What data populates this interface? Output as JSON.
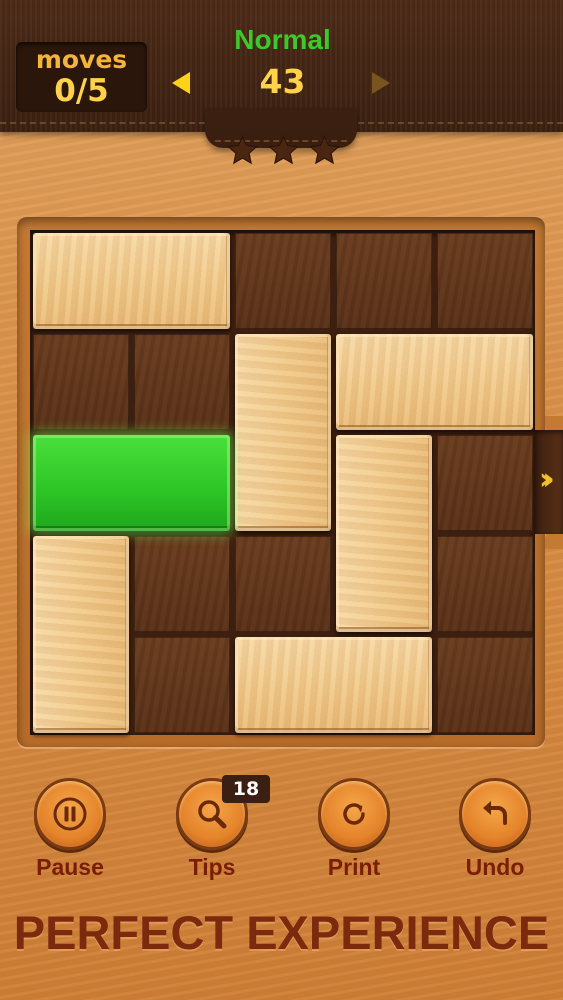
{
  "header": {
    "moves_label": "moves",
    "moves_value": "0/5",
    "difficulty": "Normal",
    "level": "43",
    "prev_level_icon": "arrow-left-icon",
    "next_level_icon": "arrow-right-icon",
    "stars_earned": 3,
    "stars_total": 3
  },
  "board": {
    "rows": 5,
    "cols": 5,
    "blocks": [
      {
        "id": "h-top",
        "type": "wood",
        "orientation": "horizontal",
        "row": 0,
        "col": 0,
        "length": 2
      },
      {
        "id": "v-mid",
        "type": "wood",
        "orientation": "vertical",
        "row": 1,
        "col": 2,
        "length": 2
      },
      {
        "id": "h-right",
        "type": "wood",
        "orientation": "horizontal",
        "row": 1,
        "col": 3,
        "length": 2
      },
      {
        "id": "target",
        "type": "target",
        "orientation": "horizontal",
        "row": 2,
        "col": 0,
        "length": 2
      },
      {
        "id": "v-center",
        "type": "wood",
        "orientation": "vertical",
        "row": 2,
        "col": 3,
        "length": 2
      },
      {
        "id": "v-left",
        "type": "wood",
        "orientation": "vertical",
        "row": 3,
        "col": 0,
        "length": 2
      },
      {
        "id": "h-bottom",
        "type": "wood",
        "orientation": "horizontal",
        "row": 4,
        "col": 2,
        "length": 2
      }
    ],
    "exit_row": 2,
    "exit_icon": "double-chevron-right-icon"
  },
  "controls": [
    {
      "label": "Pause",
      "icon": "pause-icon"
    },
    {
      "label": "Tips",
      "icon": "magnifier-icon",
      "badge": "18"
    },
    {
      "label": "Print",
      "icon": "restart-icon"
    },
    {
      "label": "Undo",
      "icon": "undo-icon"
    }
  ],
  "slogan": "PERFECT EXPERIENCE",
  "colors": {
    "target_block": "#2cc425",
    "wood_block": "#f1c98a",
    "board_dark": "#5a3118",
    "label_text": "#7a1f06",
    "level_mode": "#3cc92a",
    "level_number": "#ffd24a"
  }
}
